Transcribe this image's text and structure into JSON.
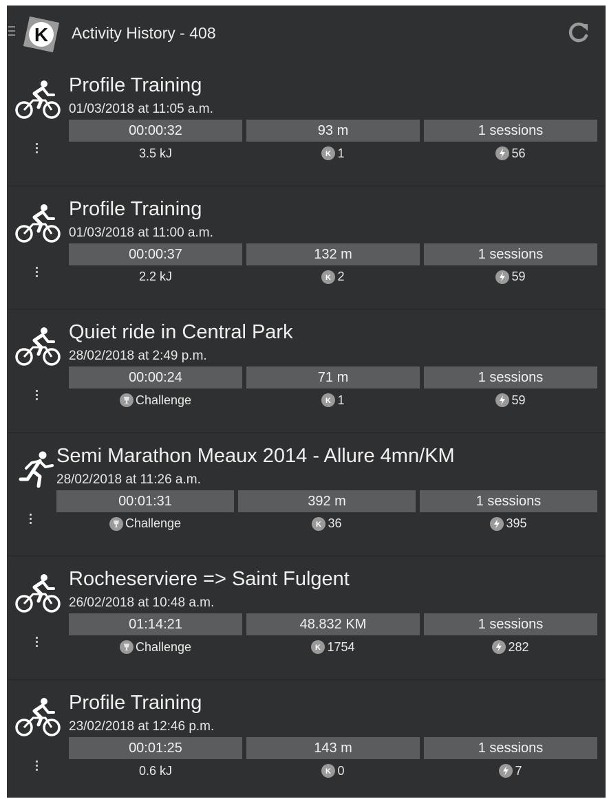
{
  "header": {
    "title": "Activity History - 408",
    "logo_letter": "K"
  },
  "activities": [
    {
      "sport": "cycling-icon",
      "title": "Profile Training",
      "date": "01/03/2018 at 11:05 a.m.",
      "duration": "00:00:32",
      "distance": "93 m",
      "sessions": "1 sessions",
      "info_left": "3.5 kJ",
      "info_left_type": "energy",
      "kpoints": "1",
      "boost": "56"
    },
    {
      "sport": "cycling-icon",
      "title": "Profile Training",
      "date": "01/03/2018 at 11:00 a.m.",
      "duration": "00:00:37",
      "distance": "132 m",
      "sessions": "1 sessions",
      "info_left": "2.2 kJ",
      "info_left_type": "energy",
      "kpoints": "2",
      "boost": "59"
    },
    {
      "sport": "cycling-icon",
      "title": "Quiet ride in Central Park",
      "date": "28/02/2018 at 2:49 p.m.",
      "duration": "00:00:24",
      "distance": "71 m",
      "sessions": "1 sessions",
      "info_left": "Challenge",
      "info_left_type": "challenge",
      "kpoints": "1",
      "boost": "59"
    },
    {
      "sport": "running-icon",
      "title": "Semi Marathon Meaux 2014 - Allure 4mn/KM",
      "date": "28/02/2018 at 11:26 a.m.",
      "duration": "00:01:31",
      "distance": "392 m",
      "sessions": "1 sessions",
      "info_left": "Challenge",
      "info_left_type": "challenge",
      "kpoints": "36",
      "boost": "395"
    },
    {
      "sport": "cycling-icon",
      "title": "Rocheserviere => Saint Fulgent",
      "date": "26/02/2018 at 10:48 a.m.",
      "duration": "01:14:21",
      "distance": "48.832 KM",
      "sessions": "1 sessions",
      "info_left": "Challenge",
      "info_left_type": "challenge",
      "kpoints": "1754",
      "boost": "282"
    },
    {
      "sport": "cycling-icon",
      "title": "Profile Training",
      "date": "23/02/2018 at 12:46 p.m.",
      "duration": "00:01:25",
      "distance": "143 m",
      "sessions": "1 sessions",
      "info_left": "0.6 kJ",
      "info_left_type": "energy",
      "kpoints": "0",
      "boost": "7"
    }
  ]
}
